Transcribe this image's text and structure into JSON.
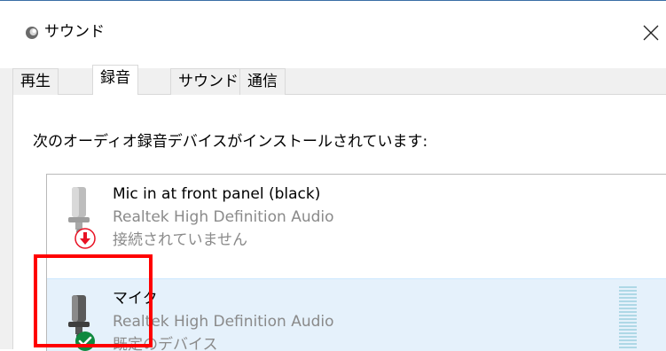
{
  "window": {
    "title": "サウンド",
    "close_glyph": "✕"
  },
  "tabs": [
    {
      "label": "再生",
      "active": false
    },
    {
      "label": "録音",
      "active": true
    },
    {
      "label": "サウンド",
      "active": false
    },
    {
      "label": "通信",
      "active": false
    }
  ],
  "panel": {
    "instruction": "次のオーディオ録音デバイスがインストールされています:"
  },
  "devices": [
    {
      "name": "Mic in at front panel (black)",
      "driver": "Realtek High Definition Audio",
      "status": "接続されていません",
      "status_icon": "disconnected-arrow-icon",
      "selected": false
    },
    {
      "name": "マイク",
      "driver": "Realtek High Definition Audio",
      "status": "既定のデバイス",
      "status_icon": "default-check-icon",
      "selected": true
    }
  ],
  "colors": {
    "selection": "#e5f1fb",
    "highlight_box": "#ff0000",
    "disconnected": "#e81123",
    "default_check": "#10893e",
    "level_meter": "#aed8e6"
  }
}
